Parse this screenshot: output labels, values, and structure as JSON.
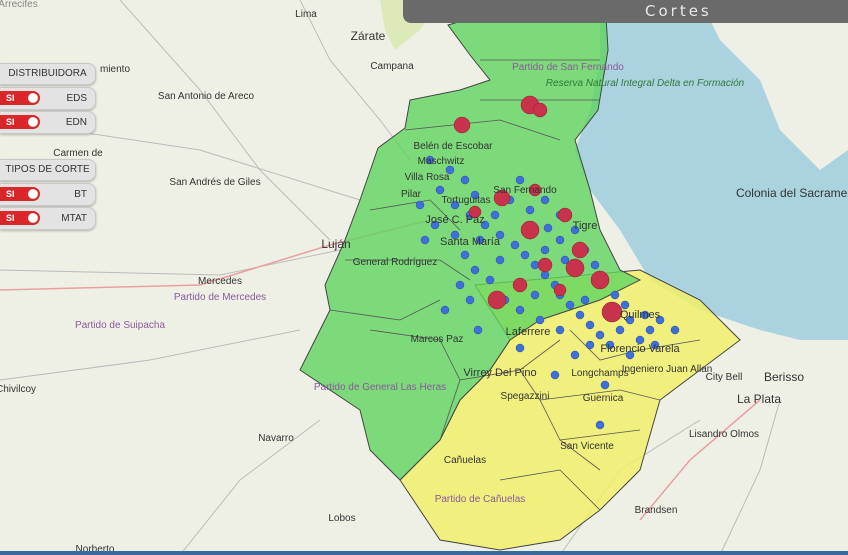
{
  "header": {
    "title": "Cortes"
  },
  "panel": {
    "distribuidora_label": "DISTRIBUIDORA",
    "tipos_label": "TIPOS DE CORTE",
    "toggles": [
      {
        "label": "EDS",
        "state": "SI"
      },
      {
        "label": "EDN",
        "state": "SI"
      },
      {
        "label": "BT",
        "state": "SI"
      },
      {
        "label": "MTAT",
        "state": "SI"
      }
    ]
  },
  "colors": {
    "green_zone": "#5fd45f",
    "yellow_zone": "#f1ef6a",
    "water": "#abd3df",
    "blue_marker": "#3f6fd8",
    "red_marker": "#c8324a",
    "toggle_on": "#d9262b"
  },
  "map_labels": {
    "places": [
      "Zárate",
      "Campana",
      "Lima",
      "San Antonio de Areco",
      "Carmen de",
      "San Andrés de Giles",
      "Luján",
      "Mercedes",
      "Navarro",
      "Lobos",
      "Brandsen",
      "Cañuelas",
      "San Vicente",
      "Guernica",
      "Longchamps",
      "Spegazzini",
      "Ingeniero Juan Allan",
      "Florencio Varela",
      "Quilmes",
      "City Bell",
      "Berisso",
      "La Plata",
      "Lisandro Olmos",
      "Colonia del Sacramento",
      "Belén de Escobar",
      "General Rodríguez",
      "Marcos Paz",
      "Virrey Del Pino",
      "Laferrere",
      "José C. Paz",
      "Santa María",
      "Pilar",
      "Tortuguitas",
      "Villa Rosa",
      "Maschwitz",
      "San Fernando",
      "Tigre",
      "Chivilcoy",
      "Norberto",
      "Arrecifes",
      "miento"
    ],
    "partidos": [
      "Partido de San Fernando",
      "Partido de Mercedes",
      "Partido de Suipacha",
      "Partido de General Las Heras",
      "Partido de Cañuelas"
    ],
    "reserve": "Reserva Natural Integral Delta en Formación"
  }
}
